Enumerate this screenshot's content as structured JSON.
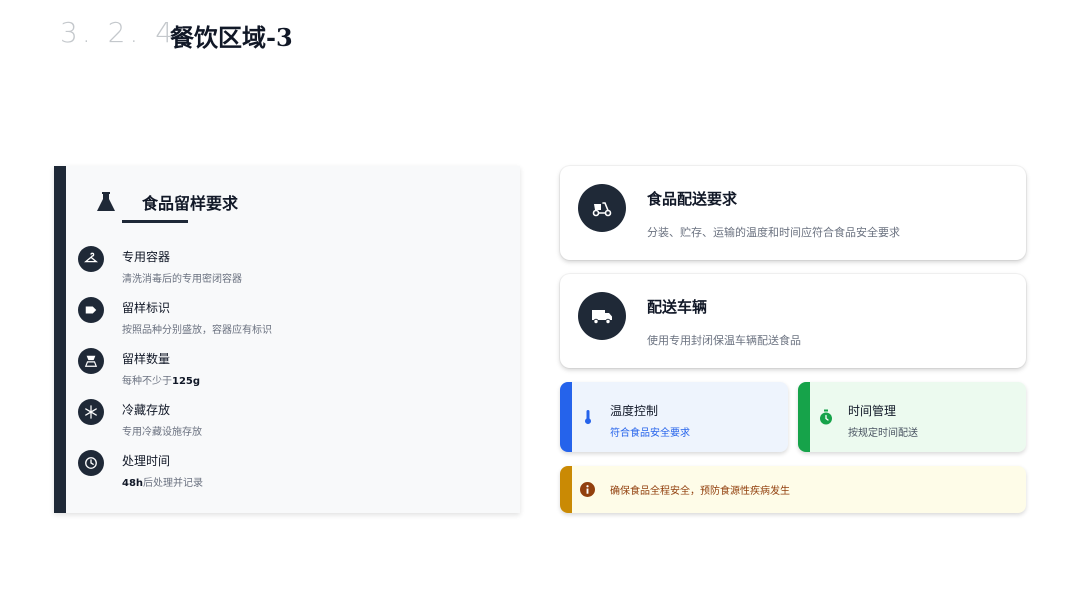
{
  "header": {
    "section_number": "3. 2. 4",
    "title": "餐饮区域-3"
  },
  "sampling": {
    "title": "食品留样要求",
    "icon": "flask-icon",
    "items": [
      {
        "title": "专用容器",
        "desc": "清洗消毒后的专用密闭容器",
        "icon": "hanger-icon"
      },
      {
        "title": "留样标识",
        "desc": "按照品种分别盛放，容器应有标识",
        "icon": "tag-icon"
      },
      {
        "title": "留样数量",
        "desc_prefix": "每种不少于",
        "desc_strong": "125g",
        "desc_suffix": "",
        "icon": "scale-icon"
      },
      {
        "title": "冷藏存放",
        "desc": "专用冷藏设施存放",
        "icon": "snowflake-icon"
      },
      {
        "title": "处理时间",
        "desc_prefix": "",
        "desc_strong": "48h",
        "desc_suffix": "后处理并记录",
        "icon": "clock-icon"
      }
    ]
  },
  "delivery": {
    "title": "食品配送要求",
    "desc": "分装、贮存、运输的温度和时间应符合食品安全要求",
    "icon": "scooter-icon"
  },
  "vehicle": {
    "title": "配送车辆",
    "desc": "使用专用封闭保温车辆配送食品",
    "icon": "truck-icon"
  },
  "temperature": {
    "title": "温度控制",
    "desc": "符合食品安全要求",
    "icon": "thermometer-icon",
    "accent": "#2563eb"
  },
  "time": {
    "title": "时间管理",
    "desc": "按规定时间配送",
    "icon": "stopwatch-icon",
    "accent": "#16a34a"
  },
  "notice": {
    "text": "确保食品全程安全，预防食源性疾病发生",
    "icon": "info-icon",
    "accent": "#ca8a04"
  }
}
